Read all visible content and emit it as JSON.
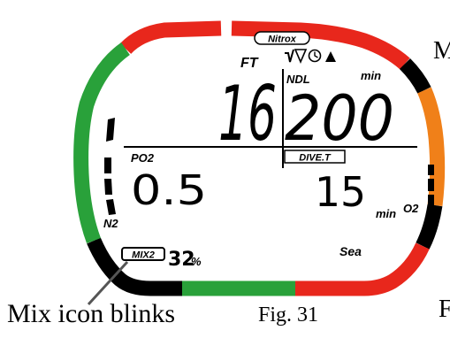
{
  "header": {
    "nitrox_badge": "Nitrox",
    "mode_icons": [
      "ascent-icon",
      "bell-icon",
      "clock-icon",
      "triangle-icon"
    ]
  },
  "depth": {
    "unit": "FT",
    "value": "16"
  },
  "ndl": {
    "label": "NDL",
    "unit": "min",
    "value": "200"
  },
  "po2": {
    "label": "PO2",
    "value": "0.5"
  },
  "dive_time": {
    "label": "DIVE.T",
    "value": "15",
    "unit": "min"
  },
  "gas": {
    "mix_label": "MIX2",
    "percent_value": "32",
    "percent_unit": "%"
  },
  "water": {
    "type": "Sea"
  },
  "bargraphs": {
    "n2_label": "N2",
    "o2_label": "O2"
  },
  "bezel_colors": {
    "red": "#e8271c",
    "green": "#29a13a",
    "orange": "#f08019",
    "black": "#000000"
  },
  "caption": {
    "text": "Mix icon blinks",
    "figure": "Fig. 31"
  },
  "edge_letters": {
    "top_right": "M",
    "bottom_right": "F"
  }
}
